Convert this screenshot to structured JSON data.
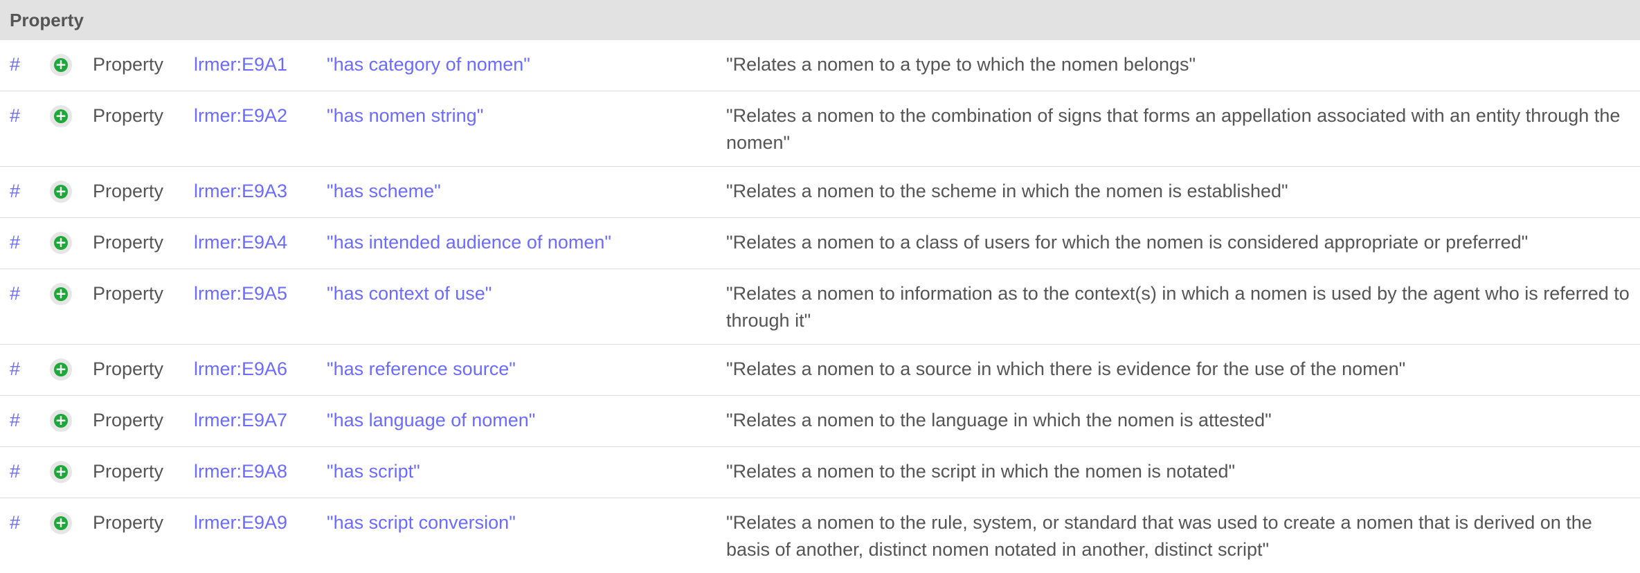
{
  "section": {
    "title": "Property"
  },
  "colors": {
    "link": "#6b6bff",
    "text": "#555555",
    "header_bg": "#e2e2e2",
    "icon_green": "#1fa83a"
  },
  "rows": [
    {
      "hash": "#",
      "icon": "plus-circle-icon",
      "type": "Property",
      "id": "lrmer:E9A1",
      "label": "\"has category of nomen\"",
      "description": "\"Relates a nomen to a type to which the nomen belongs\""
    },
    {
      "hash": "#",
      "icon": "plus-circle-icon",
      "type": "Property",
      "id": "lrmer:E9A2",
      "label": "\"has nomen string\"",
      "description": "\"Relates a nomen to the combination of signs that forms an appellation associated with an entity through the nomen\""
    },
    {
      "hash": "#",
      "icon": "plus-circle-icon",
      "type": "Property",
      "id": "lrmer:E9A3",
      "label": "\"has scheme\"",
      "description": "\"Relates a nomen to the scheme in which the nomen is established\""
    },
    {
      "hash": "#",
      "icon": "plus-circle-icon",
      "type": "Property",
      "id": "lrmer:E9A4",
      "label": "\"has intended audience of nomen\"",
      "description": "\"Relates a nomen to a class of users for which the nomen is considered appropriate or preferred\""
    },
    {
      "hash": "#",
      "icon": "plus-circle-icon",
      "type": "Property",
      "id": "lrmer:E9A5",
      "label": "\"has context of use\"",
      "description": "\"Relates a nomen to information as to the context(s) in which a nomen is used by the agent who is referred to through it\""
    },
    {
      "hash": "#",
      "icon": "plus-circle-icon",
      "type": "Property",
      "id": "lrmer:E9A6",
      "label": "\"has reference source\"",
      "description": "\"Relates a nomen to a source in which there is evidence for the use of the nomen\""
    },
    {
      "hash": "#",
      "icon": "plus-circle-icon",
      "type": "Property",
      "id": "lrmer:E9A7",
      "label": "\"has language of nomen\"",
      "description": "\"Relates a nomen to the language in which the nomen is attested\""
    },
    {
      "hash": "#",
      "icon": "plus-circle-icon",
      "type": "Property",
      "id": "lrmer:E9A8",
      "label": "\"has script\"",
      "description": "\"Relates a nomen to the script in which the nomen is notated\""
    },
    {
      "hash": "#",
      "icon": "plus-circle-icon",
      "type": "Property",
      "id": "lrmer:E9A9",
      "label": "\"has script conversion\"",
      "description": "\"Relates a nomen to the rule, system, or standard that was used to create a nomen that is derived on the basis of another, distinct nomen notated in another, distinct script\""
    }
  ]
}
